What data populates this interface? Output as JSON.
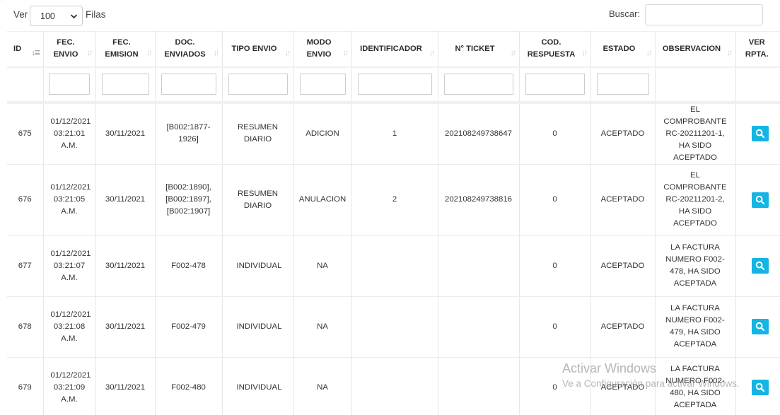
{
  "toolbar": {
    "show_label": "Ver",
    "page_size": "100",
    "rows_label": "Filas",
    "search_label": "Buscar:",
    "search_value": ""
  },
  "table": {
    "columns": [
      {
        "label": "ID"
      },
      {
        "label": "FEC. ENVIO"
      },
      {
        "label": "FEC. EMISION"
      },
      {
        "label": "DOC. ENVIADOS"
      },
      {
        "label": "TIPO ENVIO"
      },
      {
        "label": "MODO ENVIO"
      },
      {
        "label": "IDENTIFICADOR"
      },
      {
        "label": "N° TICKET"
      },
      {
        "label": "COD. RESPUESTA"
      },
      {
        "label": "ESTADO"
      },
      {
        "label": "OBSERVACION"
      },
      {
        "label": "VER RPTA."
      }
    ],
    "sort_icon": "↓↑",
    "sorted_column_icon": "↓≣",
    "rows": [
      {
        "id": "675",
        "fec_envio": "01/12/2021 03:21:01 A.M.",
        "fec_emision": "30/11/2021",
        "doc_enviados": "[B002:1877-1926]",
        "tipo_envio": "RESUMEN DIARIO",
        "modo_envio": "ADICION",
        "identificador": "1",
        "ticket": "202108249738647",
        "cod_respuesta": "0",
        "estado": "ACEPTADO",
        "observacion": "EL COMPROBANTE RC-20211201-1, HA SIDO ACEPTADO"
      },
      {
        "id": "676",
        "fec_envio": "01/12/2021 03:21:05 A.M.",
        "fec_emision": "30/11/2021",
        "doc_enviados": "[B002:1890], [B002:1897], [B002:1907]",
        "tipo_envio": "RESUMEN DIARIO",
        "modo_envio": "ANULACION",
        "identificador": "2",
        "ticket": "202108249738816",
        "cod_respuesta": "0",
        "estado": "ACEPTADO",
        "observacion": "EL COMPROBANTE RC-20211201-2, HA SIDO ACEPTADO"
      },
      {
        "id": "677",
        "fec_envio": "01/12/2021 03:21:07 A.M.",
        "fec_emision": "30/11/2021",
        "doc_enviados": "F002-478",
        "tipo_envio": "INDIVIDUAL",
        "modo_envio": "NA",
        "identificador": "",
        "ticket": "",
        "cod_respuesta": "0",
        "estado": "ACEPTADO",
        "observacion": "LA FACTURA NUMERO F002-478, HA SIDO ACEPTADA"
      },
      {
        "id": "678",
        "fec_envio": "01/12/2021 03:21:08 A.M.",
        "fec_emision": "30/11/2021",
        "doc_enviados": "F002-479",
        "tipo_envio": "INDIVIDUAL",
        "modo_envio": "NA",
        "identificador": "",
        "ticket": "",
        "cod_respuesta": "0",
        "estado": "ACEPTADO",
        "observacion": "LA FACTURA NUMERO F002-479, HA SIDO ACEPTADA"
      },
      {
        "id": "679",
        "fec_envio": "01/12/2021 03:21:09 A.M.",
        "fec_emision": "30/11/2021",
        "doc_enviados": "F002-480",
        "tipo_envio": "INDIVIDUAL",
        "modo_envio": "NA",
        "identificador": "",
        "ticket": "",
        "cod_respuesta": "0",
        "estado": "ACEPTADO",
        "observacion": "LA FACTURA NUMERO F002-480, HA SIDO ACEPTADA"
      }
    ]
  },
  "watermark": {
    "title": "Activar Windows",
    "subtitle": "Ve a Configuración para activar Windows."
  },
  "colors": {
    "view_button": "#14b4e3",
    "border": "#e4e7eb"
  },
  "icons": {
    "view_button_icon": "search-icon",
    "sort_icon": "sort-icon",
    "select_icon": "chevron-down-icon"
  }
}
